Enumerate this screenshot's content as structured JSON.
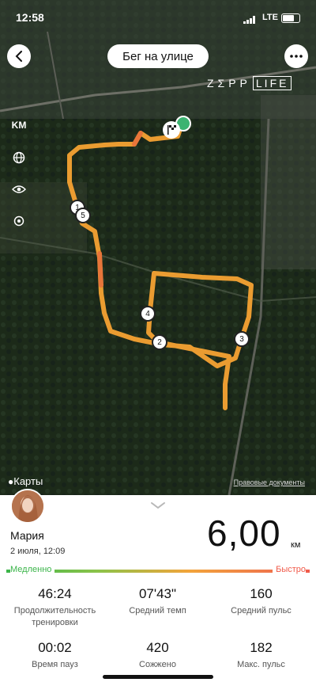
{
  "status_bar": {
    "time": "12:58",
    "carrier": "LTE"
  },
  "header": {
    "title": "Бег на улице",
    "brand_prefix": "ZΣPP",
    "brand_suffix": "LIFE"
  },
  "map_controls": {
    "unit_label": "KM"
  },
  "map_footer": {
    "maps_label": "Карты",
    "legal_link": "Правовые документы"
  },
  "route": {
    "markers": [
      "1",
      "2",
      "3",
      "4",
      "5"
    ],
    "route_color": "#f5a233",
    "start_color": "#3cb371"
  },
  "user": {
    "name": "Мария",
    "date": "2 июля, 12:09"
  },
  "summary": {
    "distance": "6,00",
    "unit": "км"
  },
  "pace_scale": {
    "slow_label": "Медленно",
    "fast_label": "Быстро",
    "slow_color": "#3bb54a",
    "fast_color": "#f05a4a"
  },
  "stats": [
    {
      "value": "46:24",
      "label": "Продолжительность тренировки"
    },
    {
      "value": "07'43\"",
      "label": "Средний темп"
    },
    {
      "value": "160",
      "label": "Средний пульс"
    },
    {
      "value": "00:02",
      "label": "Время пауз"
    },
    {
      "value": "420",
      "label": "Сожжено"
    },
    {
      "value": "182",
      "label": "Макс. пульс"
    }
  ]
}
